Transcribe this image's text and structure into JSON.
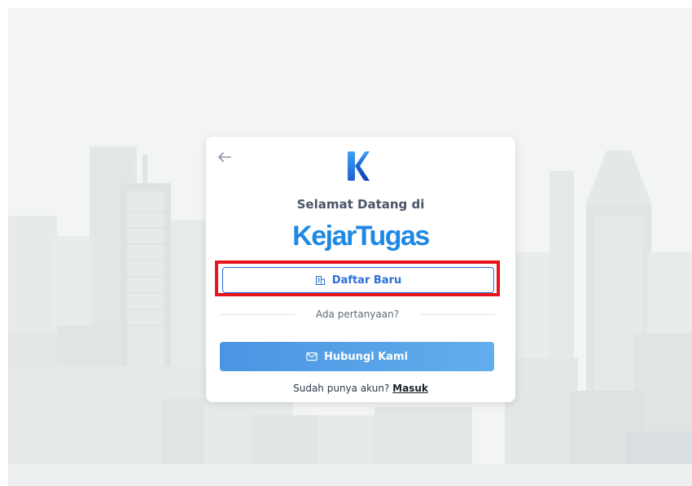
{
  "card": {
    "welcome_text": "Selamat Datang di",
    "brand_name": "KejarTugas",
    "register_label": "Daftar Baru",
    "divider_text": "Ada pertanyaan?",
    "contact_label": "Hubungi Kami",
    "login_prompt": "Sudah punya akun?",
    "login_link": "Masuk"
  },
  "icons": {
    "back": "arrow-left-icon",
    "register": "building-icon",
    "contact": "mail-icon",
    "logo": "k-logo-icon"
  },
  "colors": {
    "brand": "#1e88e5",
    "primary_button_start": "#4a94e2",
    "primary_button_end": "#62aeec",
    "outline": "#2d6fd6",
    "highlight": "#e8141c"
  }
}
